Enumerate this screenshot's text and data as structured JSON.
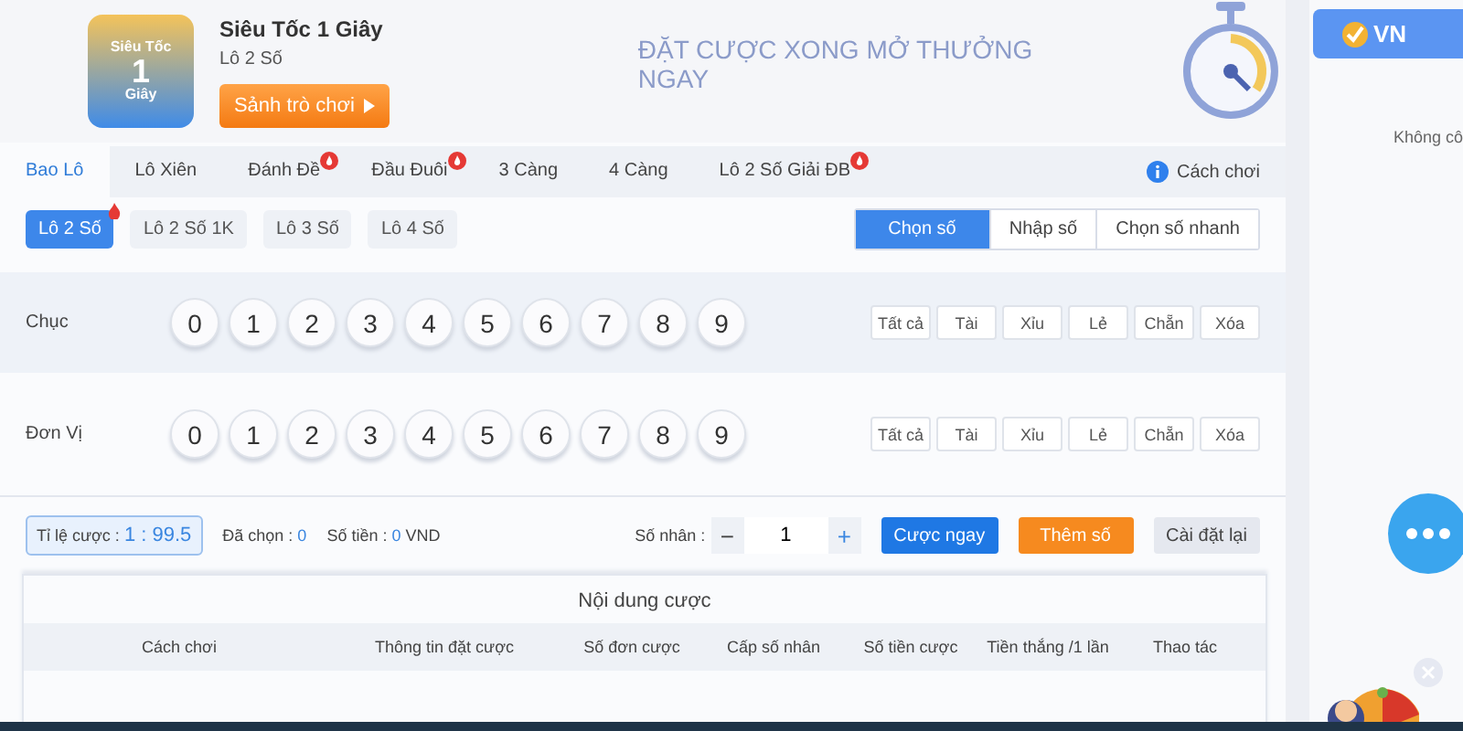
{
  "header": {
    "badge_lines": [
      "Siêu Tốc",
      "1",
      "Giây"
    ],
    "title": "Siêu Tốc 1 Giây",
    "subtitle": "Lô 2 Số",
    "lobby_button": "Sảnh trò chơi",
    "slogan": "ĐẶT CƯỢC XONG MỞ THƯỞNG NGAY"
  },
  "tabs": [
    {
      "label": "Bao Lô",
      "selected": true,
      "hot": false
    },
    {
      "label": "Lô Xiên",
      "selected": false,
      "hot": false
    },
    {
      "label": "Đánh Đề",
      "selected": false,
      "hot": true
    },
    {
      "label": "Đầu Đuôi",
      "selected": false,
      "hot": true
    },
    {
      "label": "3 Càng",
      "selected": false,
      "hot": false
    },
    {
      "label": "4 Càng",
      "selected": false,
      "hot": false
    },
    {
      "label": "Lô 2 Số Giải ĐB",
      "selected": false,
      "hot": true
    }
  ],
  "how_to": "Cách chơi",
  "subtabs": [
    {
      "label": "Lô 2 Số",
      "selected": true,
      "hot": true
    },
    {
      "label": "Lô 2 Số 1K",
      "selected": false,
      "hot": false
    },
    {
      "label": "Lô 3 Số",
      "selected": false,
      "hot": false
    },
    {
      "label": "Lô 4 Số",
      "selected": false,
      "hot": false
    }
  ],
  "modes": [
    {
      "label": "Chọn số",
      "selected": true
    },
    {
      "label": "Nhập số",
      "selected": false
    },
    {
      "label": "Chọn số nhanh",
      "selected": false
    }
  ],
  "rows": [
    {
      "label": "Chục",
      "digits": [
        "0",
        "1",
        "2",
        "3",
        "4",
        "5",
        "6",
        "7",
        "8",
        "9"
      ],
      "quick": [
        "Tất cả",
        "Tài",
        "Xỉu",
        "Lẻ",
        "Chẵn",
        "Xóa"
      ]
    },
    {
      "label": "Đơn Vị",
      "digits": [
        "0",
        "1",
        "2",
        "3",
        "4",
        "5",
        "6",
        "7",
        "8",
        "9"
      ],
      "quick": [
        "Tất cả",
        "Tài",
        "Xỉu",
        "Lẻ",
        "Chẵn",
        "Xóa"
      ]
    }
  ],
  "summary": {
    "odds_label": "Tỉ lệ cược :",
    "odds": "1 : 99.5",
    "chosen_label": "Đã chọn :",
    "chosen": "0",
    "amount_label": "Số tiền :",
    "amount": "0",
    "currency": "VND",
    "multiplier_label": "Số nhân :",
    "minus": "−",
    "multiplier": "1",
    "plus": "+"
  },
  "buttons": [
    {
      "label": "Cược ngay",
      "kind": "primary"
    },
    {
      "label": "Thêm số",
      "kind": "accent"
    },
    {
      "label": "Cài đặt lại",
      "kind": "plain"
    }
  ],
  "table": {
    "title": "Nội dung cược",
    "columns": [
      "Cách chơi",
      "Thông tin đặt cược",
      "Số đơn cược",
      "Cấp số nhân",
      "Số tiền cược",
      "Tiền thắng /1 lần",
      "Thao tác"
    ]
  },
  "sidebar": {
    "brand": "VN",
    "message": "Không cô"
  }
}
